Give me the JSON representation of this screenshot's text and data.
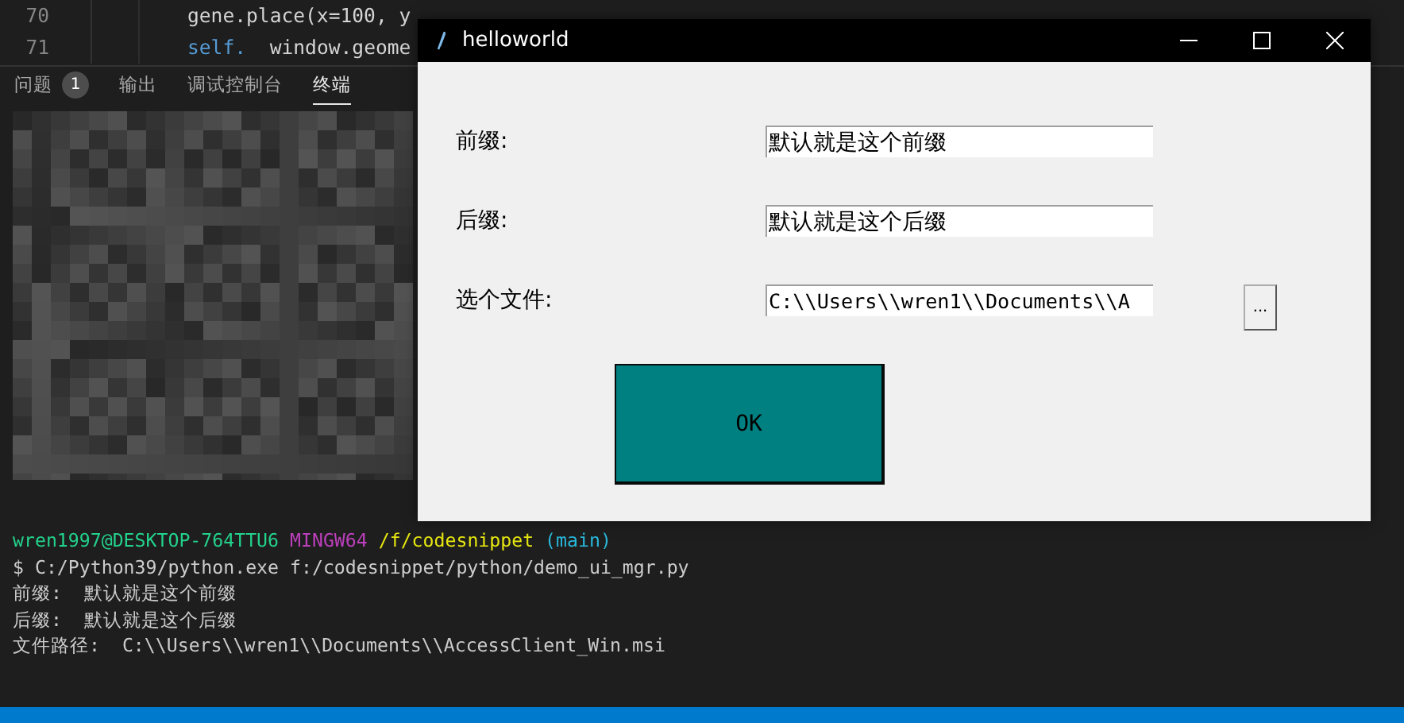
{
  "editor": {
    "lines": [
      {
        "number": "70",
        "segments": [
          {
            "kind": "plain",
            "text": "gene.place(x=100, y"
          }
        ]
      },
      {
        "number": "71",
        "segments": [
          {
            "kind": "keyword",
            "text": "self."
          },
          {
            "kind": "plain",
            "text": "  window.geome"
          }
        ]
      }
    ]
  },
  "panel": {
    "tabs": [
      {
        "label": "问题",
        "badge": "1",
        "selected": false
      },
      {
        "label": "输出",
        "selected": false
      },
      {
        "label": "调试控制台",
        "selected": false
      },
      {
        "label": "终端",
        "selected": true
      }
    ]
  },
  "terminal": {
    "prompt": [
      {
        "kind": "user",
        "text": "wren1997@DESKTOP-764TTU6"
      },
      {
        "kind": "shell",
        "text": "MINGW64"
      },
      {
        "kind": "path",
        "text": "/f/codesnippet"
      },
      {
        "kind": "branch",
        "text": "(main)"
      }
    ],
    "lines": [
      "$ C:/Python39/python.exe f:/codesnippet/python/demo_ui_mgr.py",
      "前缀:  默认就是这个前缀",
      "后缀:  默认就是这个后缀",
      "文件路径:  C:\\\\Users\\\\wren1\\\\Documents\\\\AccessClient_Win.msi"
    ]
  },
  "dialog": {
    "title": "helloworld",
    "fields": [
      {
        "kind": "text",
        "label": "前缀:",
        "value": "默认就是这个前缀"
      },
      {
        "kind": "text",
        "label": "后缀:",
        "value": "默认就是这个后缀"
      },
      {
        "kind": "file",
        "label": "选个文件:",
        "value": "C:\\\\Users\\\\wren1\\\\Documents\\\\A",
        "browse": "..."
      }
    ],
    "ok_button": "OK"
  }
}
